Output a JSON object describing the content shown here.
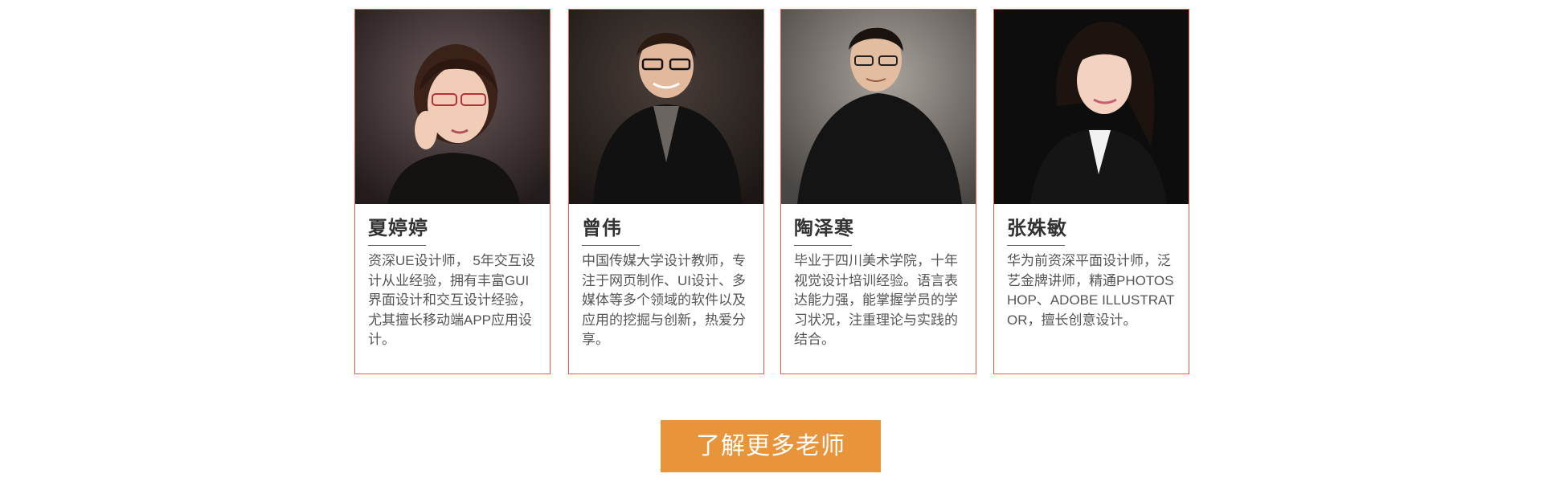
{
  "teachers": [
    {
      "name": "夏婷婷",
      "bio": "资深UE设计师， 5年交互设计从业经验，拥有丰富GUI界面设计和交互设计经验，尤其擅长移动端APP应用设计。"
    },
    {
      "name": "曾伟",
      "bio": "中国传媒大学设计教师，专注于网页制作、UI设计、多媒体等多个领域的软件以及应用的挖掘与创新，热爱分享。"
    },
    {
      "name": "陶泽寒",
      "bio": "毕业于四川美术学院，十年视觉设计培训经验。语言表达能力强，能掌握学员的学习状况，注重理论与实践的结合。"
    },
    {
      "name": "张姝敏",
      "bio": "华为前资深平面设计师，泛艺金牌讲师，精通PHOTOSHOP、ADOBE ILLUSTRATOR，擅长创意设计。"
    }
  ],
  "more_button": {
    "label": "了解更多老师"
  },
  "colors": {
    "card_border": "#e85c45",
    "button_bg": "#e8943a",
    "name_text": "#333333",
    "bio_text": "#555555"
  }
}
